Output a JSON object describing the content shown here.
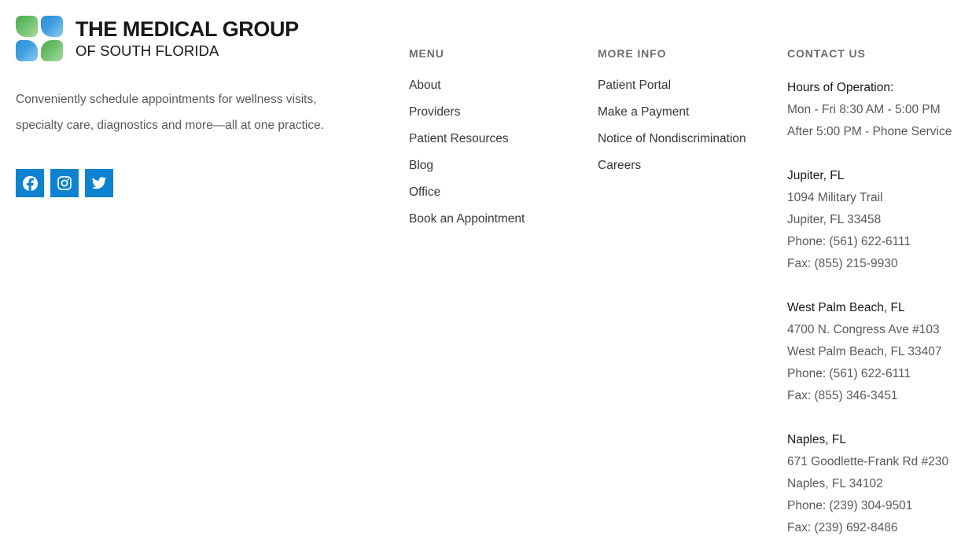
{
  "brand": {
    "logo_alt": "The Medical Group of South Florida",
    "wordmark_main": "THE MEDICAL GROUP",
    "wordmark_sub": "OF SOUTH FLORIDA",
    "tagline": "Conveniently schedule appointments for wellness visits, specialty care, diagnostics and more—all at one practice.",
    "accent_color": "#0c82d0",
    "logo_green": "#5cb85c",
    "logo_blue": "#3f9fe0",
    "social": [
      {
        "name": "facebook",
        "label": "Facebook"
      },
      {
        "name": "instagram",
        "label": "Instagram"
      },
      {
        "name": "twitter",
        "label": "Twitter"
      }
    ]
  },
  "menu": {
    "heading": "MENU",
    "items": [
      {
        "label": "About"
      },
      {
        "label": "Providers"
      },
      {
        "label": "Patient Resources"
      },
      {
        "label": "Blog"
      },
      {
        "label": "Office"
      },
      {
        "label": "Book an Appointment"
      }
    ]
  },
  "more_info": {
    "heading": "MORE INFO",
    "items": [
      {
        "label": "Patient Portal"
      },
      {
        "label": "Make a Payment"
      },
      {
        "label": "Notice of Nondiscrimination"
      },
      {
        "label": "Careers"
      }
    ]
  },
  "contact": {
    "heading": "CONTACT US",
    "hours": {
      "title": "Hours of Operation:",
      "lines": [
        "Mon - Fri 8:30 AM - 5:00 PM",
        "After 5:00 PM - Phone Service"
      ]
    },
    "locations": [
      {
        "title": "Jupiter, FL",
        "street": "1094 Military Trail",
        "city_state_zip": "Jupiter, FL 33458",
        "phone": "Phone: (561) 622-6111",
        "fax": "Fax: (855) 215-9930"
      },
      {
        "title": "West Palm Beach, FL",
        "street": "4700 N. Congress Ave #103",
        "city_state_zip": "West Palm Beach, FL 33407",
        "phone": "Phone: (561) 622-6111",
        "fax": "Fax: (855) 346-3451"
      },
      {
        "title": "Naples, FL",
        "street": "671 Goodlette-Frank Rd #230",
        "city_state_zip": "Naples, FL 34102",
        "phone": "Phone: (239) 304-9501",
        "fax": "Fax: (239) 692-8486"
      }
    ]
  }
}
